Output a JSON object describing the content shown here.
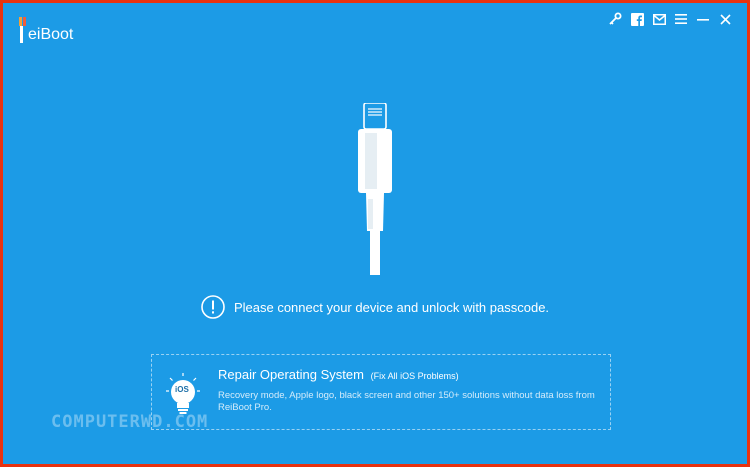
{
  "app": {
    "name": "ReiBoot",
    "logo_letter": "R",
    "logo_rest": "eiBoot"
  },
  "titlebar_icons": [
    "key-icon",
    "facebook-icon",
    "mail-icon",
    "menu-icon",
    "minimize-icon",
    "close-icon"
  ],
  "main": {
    "message": "Please connect your device and unlock with passcode."
  },
  "repair": {
    "icon_label": "iOS",
    "title": "Repair Operating System",
    "subtitle": "(Fix All iOS Problems)",
    "description": "Recovery mode, Apple logo, black screen and other 150+ solutions without data loss from ReiBoot Pro."
  },
  "watermark": "COMPUTERWD.COM",
  "colors": {
    "background": "#1c9be6",
    "border": "#e8320f",
    "text": "#ffffff"
  }
}
